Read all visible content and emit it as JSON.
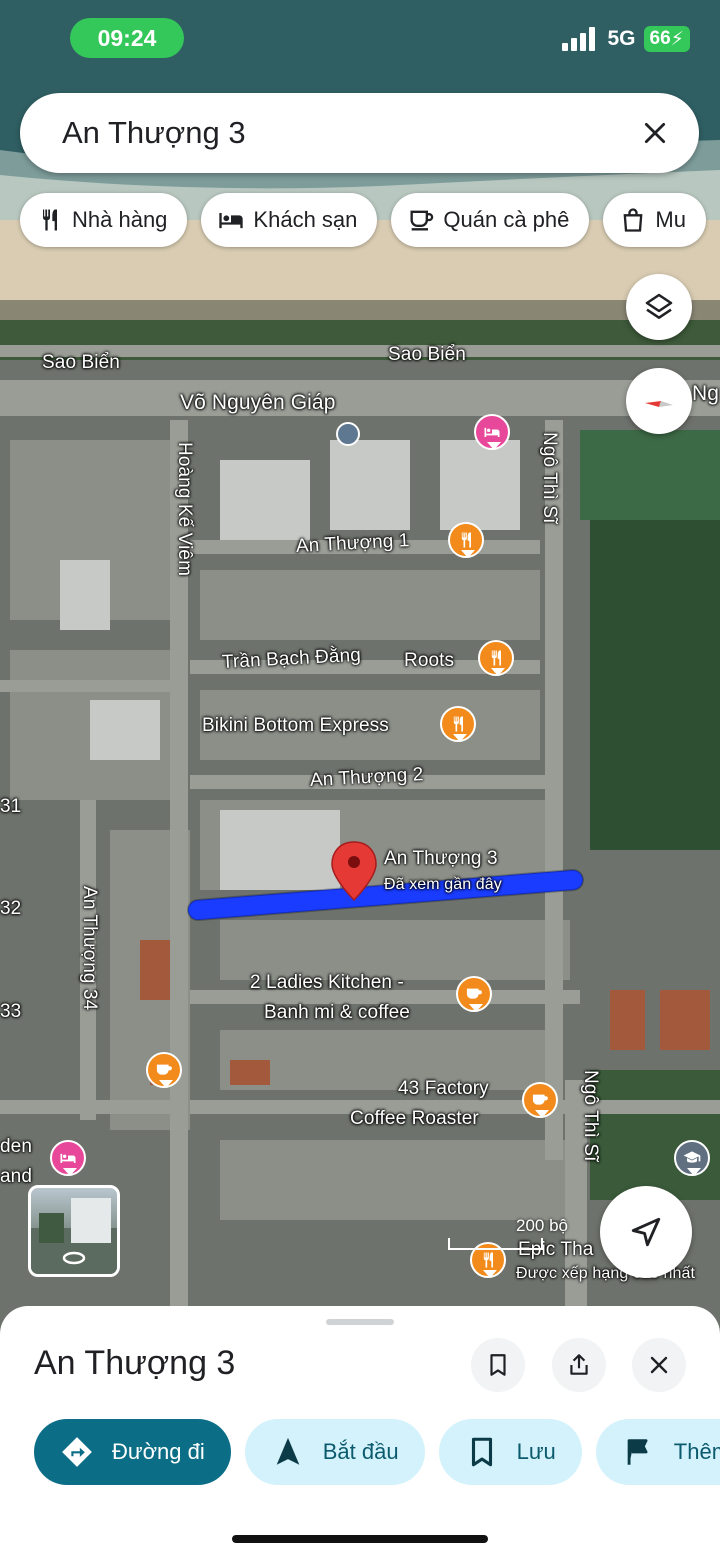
{
  "status_bar": {
    "time": "09:24",
    "network": "5G",
    "battery": "66"
  },
  "search": {
    "query": "An Thượng 3"
  },
  "chips": [
    {
      "label": "Nhà hàng",
      "icon": "restaurant-icon"
    },
    {
      "label": "Khách sạn",
      "icon": "hotel-icon"
    },
    {
      "label": "Quán cà phê",
      "icon": "coffee-icon"
    },
    {
      "label": "Mu",
      "icon": "shopping-bag-icon"
    }
  ],
  "map": {
    "labels": {
      "sao_bien_1": "Sao Biển",
      "sao_bien_2": "Sao Biển",
      "vo_nguyen_giap": "Võ Nguyên Giáp",
      "ng_edge": "Ng",
      "hoang_ke_viem": "Hoàng Kế Viêm",
      "ngo_thi_si_1": "Ngô Thì Sĩ",
      "ngo_thi_si_2": "Ngô Thì Sĩ",
      "an_thuong_1": "An Thượng 1",
      "tran_bach_dang": "Trần Bạch Đằng",
      "roots": "Roots",
      "bikini": "Bikini Bottom Express",
      "an_thuong_2": "An Thượng 2",
      "an_thuong_34": "An Thượng 34",
      "edge_31": "31",
      "edge_32": "32",
      "edge_33": "33",
      "edge_den": "den",
      "edge_and": "and",
      "ladies_1": "2 Ladies Kitchen -",
      "ladies_2": "Banh mi & coffee",
      "factory_1": "43 Factory",
      "factory_2": "Coffee Roaster",
      "epic": "Epic Tha",
      "epic_sub": "Được xếp hạng cao nhất"
    },
    "selected": {
      "name": "An Thượng 3",
      "subtitle": "Đã xem gần đây"
    },
    "scale_label": "200 bộ"
  },
  "sheet": {
    "title": "An Thượng 3",
    "actions": [
      {
        "label": "Đường đi",
        "icon": "directions-icon"
      },
      {
        "label": "Bắt đầu",
        "icon": "navigation-arrow-icon"
      },
      {
        "label": "Lưu",
        "icon": "bookmark-icon"
      },
      {
        "label": "Thêm",
        "icon": "flag-icon"
      }
    ]
  },
  "colors": {
    "primary": "#0b6e86",
    "chip_bg": "#d3f2fb",
    "route": "#1a3cff",
    "pin_food": "#f28b1c",
    "pin_hotel": "#e8489a",
    "status_green": "#34c759"
  }
}
